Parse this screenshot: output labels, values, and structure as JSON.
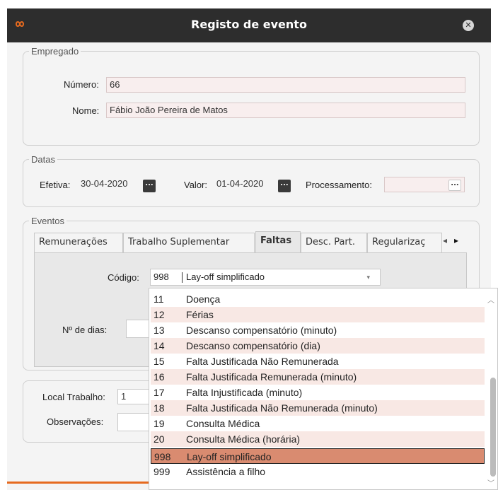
{
  "window": {
    "title": "Registo de evento",
    "close_glyph": "✕",
    "logo_icon": "infinity-icon",
    "accent_color": "#e66a1f"
  },
  "empregado": {
    "legend": "Empregado",
    "numero_label": "Número:",
    "numero_value": "66",
    "nome_label": "Nome:",
    "nome_value": "Fábio João Pereira de Matos"
  },
  "datas": {
    "legend": "Datas",
    "efetiva_label": "Efetiva:",
    "efetiva_value": "30-04-2020",
    "valor_label": "Valor:",
    "valor_value": "01-04-2020",
    "processamento_label": "Processamento:",
    "processamento_value": "",
    "picker_glyph": "..."
  },
  "eventos": {
    "legend": "Eventos",
    "tabs": [
      {
        "label": "Remunerações"
      },
      {
        "label": "Trabalho Suplementar"
      },
      {
        "label": "Faltas"
      },
      {
        "label": "Desc. Part."
      },
      {
        "label": "Regularizaç"
      }
    ],
    "tab_scroll_left": "◂",
    "tab_scroll_right": "▸",
    "codigo_label": "Código:",
    "codigo_code": "998",
    "codigo_desc": "Lay-off simplificado",
    "combo_arrow": "▾",
    "dias_label": "Nº de dias:"
  },
  "extra": {
    "local_label": "Local Trabalho:",
    "local_value": "1",
    "obs_label": "Observações:"
  },
  "dropdown": {
    "scroll_up": "︿",
    "scroll_down": "﹀",
    "items": [
      {
        "code": "11",
        "desc": "Doença"
      },
      {
        "code": "12",
        "desc": "Férias"
      },
      {
        "code": "13",
        "desc": "Descanso compensatório (minuto)"
      },
      {
        "code": "14",
        "desc": "Descanso compensatório (dia)"
      },
      {
        "code": "15",
        "desc": "Falta Justificada Não Remunerada"
      },
      {
        "code": "16",
        "desc": "Falta Justificada Remunerada (minuto)"
      },
      {
        "code": "17",
        "desc": "Falta Injustificada (minuto)"
      },
      {
        "code": "18",
        "desc": "Falta Justificada Não Remunerada (minuto)"
      },
      {
        "code": "19",
        "desc": "Consulta Médica"
      },
      {
        "code": "20",
        "desc": "Consulta Médica (horária)"
      },
      {
        "code": "998",
        "desc": "Lay-off simplificado"
      },
      {
        "code": "999",
        "desc": "Assistência a filho"
      }
    ],
    "selected_code": "998"
  }
}
